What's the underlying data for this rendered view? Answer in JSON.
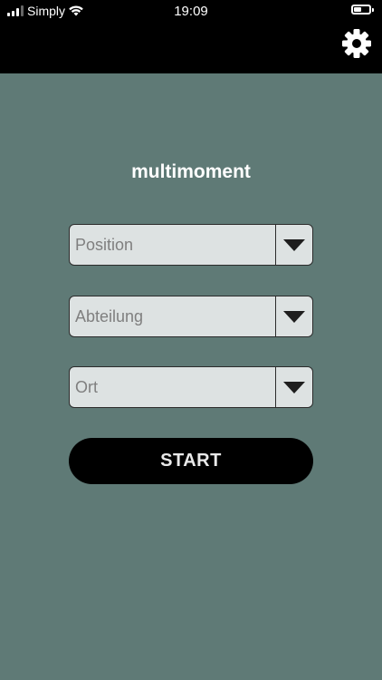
{
  "status_bar": {
    "carrier": "Simply",
    "time": "19:09",
    "battery_level": 0.5
  },
  "header": {
    "settings_icon": "gear-icon"
  },
  "main": {
    "title": "multimoment",
    "dropdowns": [
      {
        "placeholder": "Position"
      },
      {
        "placeholder": "Abteilung"
      },
      {
        "placeholder": "Ort"
      }
    ],
    "start_label": "START"
  },
  "colors": {
    "background": "#5f7a76",
    "topbar": "#000000",
    "dropdown_fill": "#dde2e2",
    "button": "#000000"
  }
}
